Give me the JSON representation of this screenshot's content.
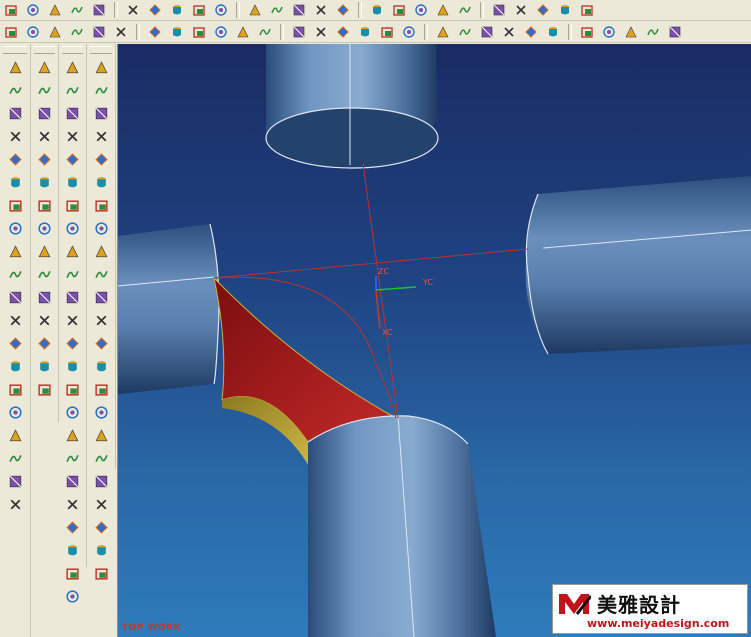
{
  "viewport": {
    "view_label": "TOP WORK",
    "axis_labels": {
      "zc": "ZC",
      "yc": "YC",
      "xc": "XC"
    }
  },
  "watermark": {
    "chinese": "美雅設計",
    "url": "www.meiyadesign.com"
  },
  "colors": {
    "background_top": "#1A2C63",
    "background_bottom": "#2E7BBB",
    "cylinder": "#6F8FB6",
    "fillet_face": "#9E1B1B",
    "fillet_edge": "#C8B23A",
    "wcs_x": "#C0392B",
    "wcs_y": "#1DBF3A",
    "wcs_z": "#2F6BFF",
    "watermark_red": "#C0141A"
  },
  "toolbar_row1_icons": [
    "new-file-icon",
    "open-file-icon",
    "save-icon",
    "print-icon",
    "cut-icon",
    "copy-icon",
    "paste-icon",
    "delete-icon",
    "undo-icon",
    "redo-icon",
    "fit-view-icon",
    "zoom-icon",
    "zoom-box-icon",
    "rotate-icon",
    "pan-icon",
    "shaded-view-icon",
    "wireframe-view-icon",
    "color-icon",
    "layer-icon",
    "render-icon",
    "part-navigator-icon",
    "grid-icon",
    "help-icon",
    "snap-icon",
    "measure-icon"
  ],
  "toolbar_row2_icons": [
    "line-icon",
    "trim-icon",
    "point-icon",
    "curve-icon",
    "arc-icon",
    "spline-icon",
    "point-set-icon",
    "polyline-icon",
    "rectangle-icon",
    "circle-icon",
    "ellipse-icon",
    "helix-icon",
    "text-icon",
    "offset-curve-icon",
    "bridge-curve-icon",
    "project-curve-icon",
    "intersect-curve-icon",
    "section-curve-icon",
    "extract-curve-icon",
    "combined-curve-icon",
    "wrap-curve-icon",
    "isoparametric-icon",
    "law-curve-icon",
    "fillet-curve-icon",
    "chamfer-curve-icon",
    "edit-curve-icon",
    "analysis-icon",
    "hand-icon",
    "hand-select-icon"
  ],
  "side_col1_icons": [
    "sketch-icon",
    "extrude-icon",
    "revolve-icon",
    "datum-plane-icon",
    "datum-axis-icon",
    "block-icon",
    "cylinder-icon",
    "cone-icon",
    "sphere-icon",
    "tube-icon",
    "boss-icon",
    "pocket-icon",
    "pad-icon",
    "slot-icon",
    "groove-icon",
    "user-feature-icon",
    "unite-icon",
    "subtract-icon",
    "intersect-icon",
    "trim-body-icon"
  ],
  "side_col2_icons": [
    "surface-grid-icon",
    "ruled-icon",
    "through-curves-icon",
    "through-mesh-icon",
    "swept-icon",
    "section-icon",
    "bridge-icon",
    "n-sided-icon",
    "transition-icon",
    "extension-icon",
    "offset-surface-icon",
    "trim-sheet-icon",
    "sew-icon",
    "fillet-surface-icon",
    "bounded-plane-icon"
  ],
  "side_col3_icons": [
    "edge-blend-icon",
    "face-blend-icon",
    "soft-blend-icon",
    "chamfer-icon",
    "hollow-icon",
    "draft-icon",
    "thicken-icon",
    "scale-icon",
    "shell-icon",
    "split-body-icon",
    "patch-icon",
    "offset-face-icon",
    "emboss-icon",
    "wrap-geometry-icon",
    "simplify-icon",
    "mirror-icon",
    "pattern-icon",
    "thread-icon",
    "hole-icon",
    "mesh-surface-icon",
    "box-shape-icon",
    "cylinder-shape-icon",
    "cone-shape-icon",
    "sphere-shape-icon"
  ],
  "side_col4_icons": [
    "view-iso-icon",
    "view-front-icon",
    "view-top-icon",
    "view-right-icon",
    "view-back-icon",
    "view-left-icon",
    "view-bottom-icon",
    "snap-view-icon",
    "edit-face-icon",
    "move-face-icon",
    "resize-face-icon",
    "offset-region-icon",
    "replace-face-icon",
    "delete-face-icon",
    "reuse-icon",
    "group-face-icon",
    "analysis-face-icon",
    "radius-face-icon",
    "blend-face-icon",
    "rotate-face-icon",
    "green-face-icon",
    "select-face-icon",
    "convert-face-icon"
  ]
}
